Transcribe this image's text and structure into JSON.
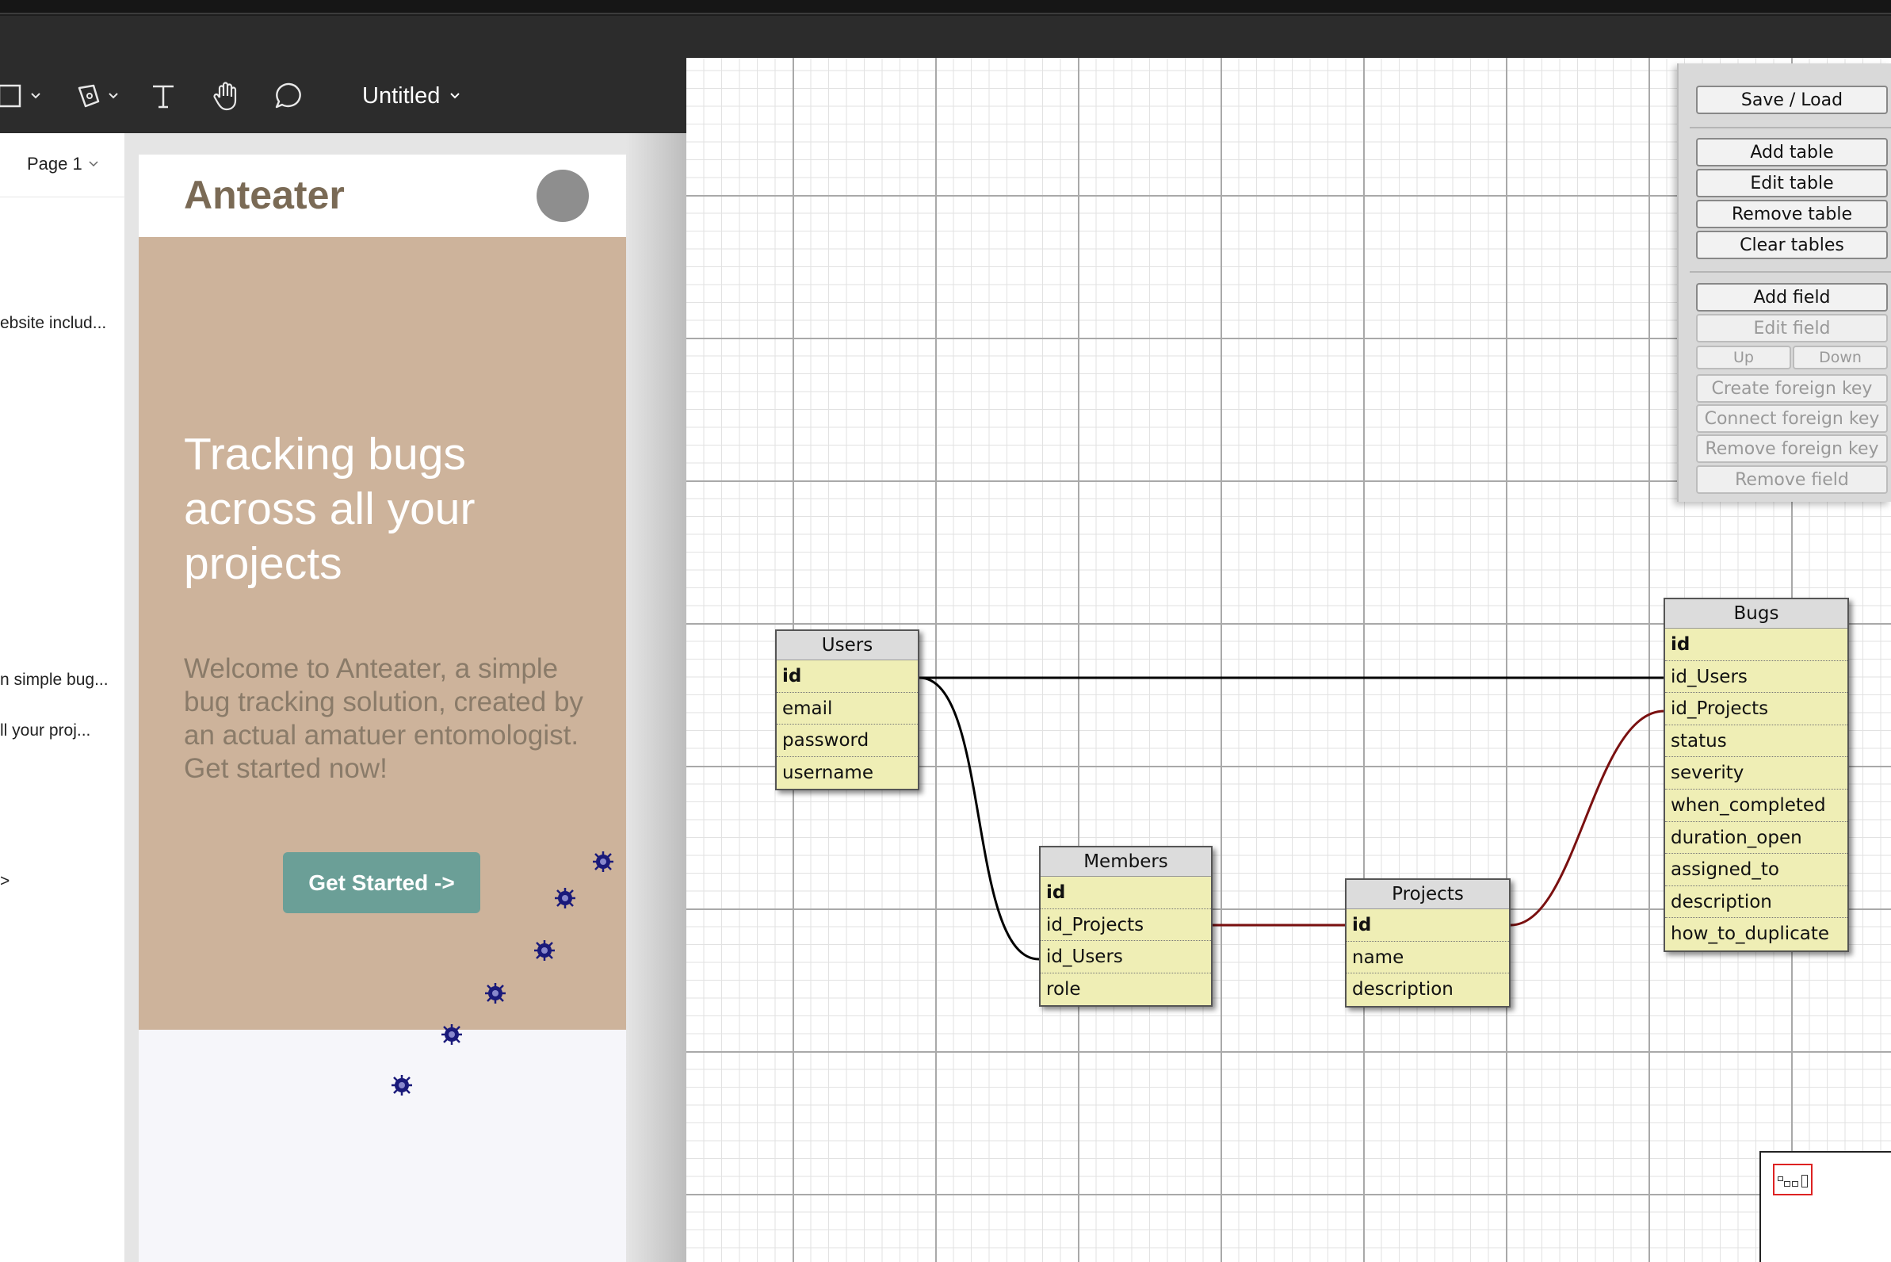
{
  "toolbar": {
    "doc_title": "Untitled",
    "tools": [
      "frame-icon",
      "pen-icon",
      "text-icon",
      "hand-icon",
      "comment-icon"
    ]
  },
  "left_panel": {
    "page_selector": "Page 1",
    "layers": [
      "ebsite includ...",
      "n simple bug...",
      "ll your proj...",
      ">"
    ]
  },
  "mockup": {
    "brand": "Anteater",
    "headline": "Tracking bugs across all your projects",
    "subtitle": "Welcome to Anteater, a simple bug tracking solution, created by an actual amatuer entomologist. Get started now!",
    "cta": "Get Started ->",
    "colors": {
      "hero": "#cdb39b",
      "brand_text": "#7a6a55",
      "cta": "#6b9f97",
      "bug": "#1a1a7a"
    }
  },
  "schema": {
    "tables": [
      {
        "name": "Users",
        "fields": [
          "id",
          "email",
          "password",
          "username"
        ]
      },
      {
        "name": "Members",
        "fields": [
          "id",
          "id_Projects",
          "id_Users",
          "role"
        ]
      },
      {
        "name": "Projects",
        "fields": [
          "id",
          "name",
          "description"
        ]
      },
      {
        "name": "Bugs",
        "fields": [
          "id",
          "id_Users",
          "id_Projects",
          "status",
          "severity",
          "when_completed",
          "duration_open",
          "assigned_to",
          "description",
          "how_to_duplicate"
        ]
      }
    ],
    "relations": [
      {
        "from": "Users.id",
        "to": "Bugs.id_Users"
      },
      {
        "from": "Users.id",
        "to": "Members.id_Users"
      },
      {
        "from": "Projects.id",
        "to": "Members.id_Projects"
      },
      {
        "from": "Projects.id",
        "to": "Bugs.id_Projects"
      }
    ]
  },
  "controls": {
    "save_load": "Save / Load",
    "add_table": "Add table",
    "edit_table": "Edit table",
    "remove_table": "Remove table",
    "clear_tables": "Clear tables",
    "add_field": "Add field",
    "edit_field": "Edit field",
    "up": "Up",
    "down": "Down",
    "create_fk": "Create foreign key",
    "connect_fk": "Connect foreign key",
    "remove_fk": "Remove foreign key",
    "remove_field": "Remove field"
  }
}
